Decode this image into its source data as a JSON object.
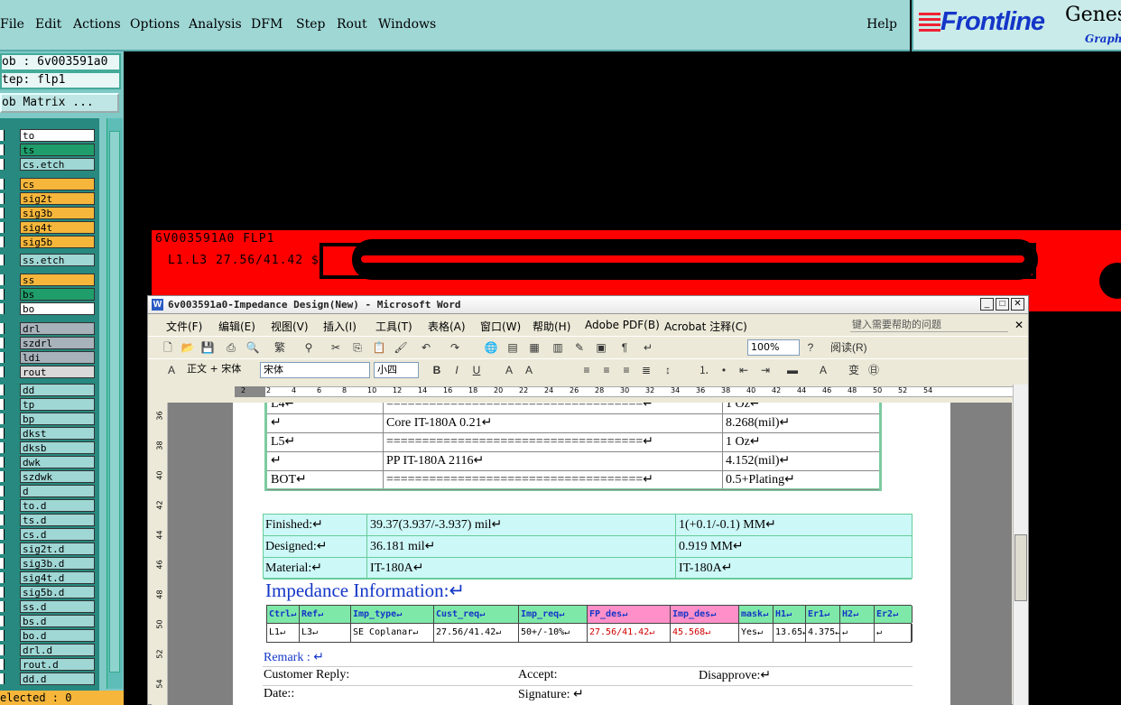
{
  "genesis": {
    "menu": [
      "File",
      "Edit",
      "Actions",
      "Options",
      "Analysis",
      "DFM",
      "Step",
      "Rout",
      "Windows"
    ],
    "help": "Help",
    "logo": {
      "brand": "Frontline",
      "product": "Genes",
      "sub": "Graphi"
    },
    "job_label": "ob : 6v003591a0",
    "step_label": "tep: flp1",
    "job_matrix": "ob Matrix ...",
    "selected": "elected : 0",
    "layers": [
      {
        "name": "to",
        "color": "#ffffff"
      },
      {
        "name": "ts",
        "color": "#1f9e6c"
      },
      {
        "name": "cs.etch",
        "color": "#9fd7d5"
      },
      {
        "name": "cs",
        "color": "#f5b63b"
      },
      {
        "name": "sig2t",
        "color": "#f5b63b"
      },
      {
        "name": "sig3b",
        "color": "#f5b63b"
      },
      {
        "name": "sig4t",
        "color": "#f5b63b"
      },
      {
        "name": "sig5b",
        "color": "#f5b63b"
      },
      {
        "name": "ss.etch",
        "color": "#9fd7d5"
      },
      {
        "name": "ss",
        "color": "#f5b63b"
      },
      {
        "name": "bs",
        "color": "#1f9e6c"
      },
      {
        "name": "bo",
        "color": "#ffffff"
      },
      {
        "name": "drl",
        "color": "#a8b2bb"
      },
      {
        "name": "szdrl",
        "color": "#a8b2bb"
      },
      {
        "name": "ldi",
        "color": "#a8b2bb"
      },
      {
        "name": "rout",
        "color": "#d9d9d9"
      },
      {
        "name": "dd",
        "color": "#9fd7d5"
      },
      {
        "name": "tp",
        "color": "#9fd7d5"
      },
      {
        "name": "bp",
        "color": "#9fd7d5"
      },
      {
        "name": "dkst",
        "color": "#9fd7d5"
      },
      {
        "name": "dksb",
        "color": "#9fd7d5"
      },
      {
        "name": "dwk",
        "color": "#9fd7d5"
      },
      {
        "name": "szdwk",
        "color": "#9fd7d5"
      },
      {
        "name": "d",
        "color": "#9fd7d5"
      },
      {
        "name": "to.d",
        "color": "#9fd7d5"
      },
      {
        "name": "ts.d",
        "color": "#9fd7d5"
      },
      {
        "name": "cs.d",
        "color": "#9fd7d5"
      },
      {
        "name": "sig2t.d",
        "color": "#9fd7d5"
      },
      {
        "name": "sig3b.d",
        "color": "#9fd7d5"
      },
      {
        "name": "sig4t.d",
        "color": "#9fd7d5"
      },
      {
        "name": "sig5b.d",
        "color": "#9fd7d5"
      },
      {
        "name": "ss.d",
        "color": "#9fd7d5"
      },
      {
        "name": "bs.d",
        "color": "#9fd7d5"
      },
      {
        "name": "bo.d",
        "color": "#9fd7d5"
      },
      {
        "name": "drl.d",
        "color": "#9fd7d5"
      },
      {
        "name": "rout.d",
        "color": "#9fd7d5"
      },
      {
        "name": "dd.d",
        "color": "#9fd7d5"
      }
    ],
    "canvas_label1": "6V003591A0 FLP1",
    "canvas_label2": "L1.L3 27.56/41.42 $"
  },
  "word": {
    "title": "6v003591a0-Impedance Design(New) - Microsoft Word",
    "menu": [
      "文件(F)",
      "编辑(E)",
      "视图(V)",
      "插入(I)",
      "工具(T)",
      "表格(A)",
      "窗口(W)",
      "帮助(H)",
      "Adobe PDF(B)",
      "Acrobat 注释(C)"
    ],
    "help_placeholder": "键入需要帮助的问题",
    "zoom": "100%",
    "read_label": "阅读(R)",
    "style": "正文 + 宋体",
    "font": "宋体",
    "size": "小四",
    "ruler": [
      "2",
      "2",
      "4",
      "6",
      "8",
      "10",
      "12",
      "14",
      "16",
      "18",
      "20",
      "22",
      "24",
      "26",
      "28",
      "30",
      "32",
      "34",
      "36",
      "38",
      "40",
      "42",
      "44",
      "46",
      "48",
      "50",
      "52",
      "54"
    ],
    "vruler": [
      "36",
      "38",
      "40",
      "42",
      "44",
      "46",
      "48",
      "50",
      "52",
      "54"
    ],
    "stack": [
      {
        "c1": "L4↵",
        "c2": "====================================↵",
        "c3": "1 Oz↵"
      },
      {
        "c1": "↵",
        "c2": "Core    IT-180A    0.21↵",
        "c3": "8.268(mil)↵"
      },
      {
        "c1": "L5↵",
        "c2": "====================================↵",
        "c3": "1 Oz↵"
      },
      {
        "c1": "↵",
        "c2": "PP    IT-180A    2116↵",
        "c3": "4.152(mil)↵"
      },
      {
        "c1": "BOT↵",
        "c2": "====================================↵",
        "c3": "0.5+Plating↵"
      }
    ],
    "specs": [
      {
        "label": "Finished:↵",
        "mil": "39.37(3.937/-3.937) mil↵",
        "mm": "1(+0.1/-0.1) MM↵"
      },
      {
        "label": "Designed:↵",
        "mil": "36.181 mil↵",
        "mm": "0.919 MM↵"
      },
      {
        "label": "Material:↵",
        "mil": "IT-180A↵",
        "mm": "IT-180A↵"
      }
    ],
    "impedance_title": "Impedance Information:↵",
    "imp_headers": [
      "Ctrl↵",
      "Ref↵",
      "Imp_type↵",
      "Cust_req↵",
      "Imp_req↵",
      "FP_des↵",
      "Imp_des↵",
      "mask↵",
      "H1↵",
      "Er1↵",
      "H2↵",
      "Er2↵"
    ],
    "imp_values": [
      "L1↵",
      "L3↵",
      "SE Coplanar↵",
      "27.56/41.42↵",
      "50+/-10%↵",
      "27.56/41.42↵",
      "45.568↵",
      "Yes↵",
      "13.65↵",
      "4.375↵",
      "↵",
      "↵"
    ],
    "remark": "Remark :  ↵",
    "reply": "Customer Reply:",
    "accept": "Accept:",
    "disapprove": "Disapprove:↵",
    "date": "Date::",
    "signature": "Signature: ↵"
  }
}
